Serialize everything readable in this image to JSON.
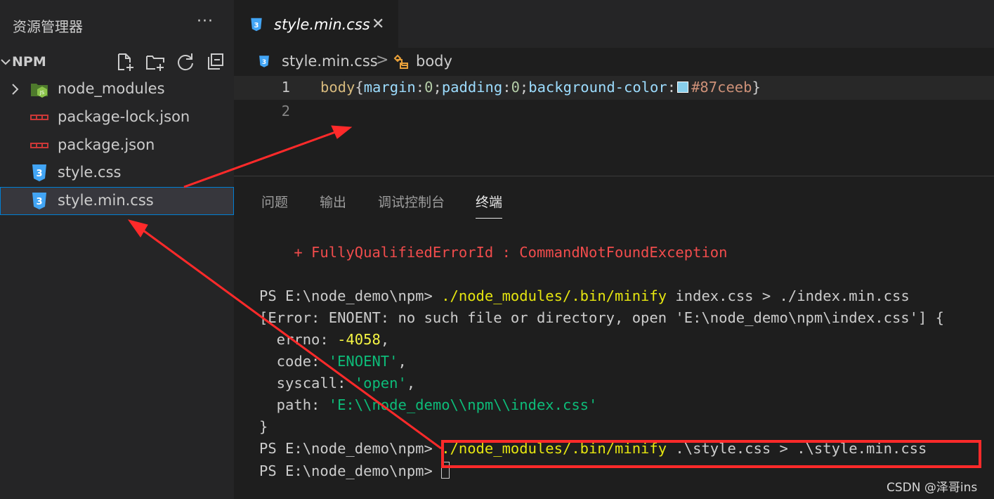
{
  "explorer": {
    "title": "资源管理器",
    "more_label": "···",
    "folder_name": "NPM",
    "files": [
      {
        "name": "node_modules",
        "icon": "nodejs-folder-icon",
        "kind": "folder"
      },
      {
        "name": "package-lock.json",
        "icon": "npm-icon",
        "kind": "file"
      },
      {
        "name": "package.json",
        "icon": "npm-icon",
        "kind": "file"
      },
      {
        "name": "style.css",
        "icon": "css3-icon",
        "kind": "file"
      },
      {
        "name": "style.min.css",
        "icon": "css3-icon",
        "kind": "file",
        "selected": true
      }
    ]
  },
  "editor": {
    "tab": {
      "label": "style.min.css",
      "close": "✕"
    },
    "breadcrumb": {
      "file": "style.min.css",
      "separator": ">",
      "symbol": "body"
    },
    "line_numbers": [
      "1",
      "2"
    ],
    "code_line1": {
      "selector": "body",
      "open": "{",
      "prop1": "margin",
      "colon1": ":",
      "val1": "0",
      "semi1": ";",
      "prop2": "padding",
      "colon2": ":",
      "val2": "0",
      "semi2": ";",
      "prop3": "background-color",
      "colon3": ":",
      "val3": "#87ceeb",
      "close": "}"
    },
    "swatch_color": "#87ceeb"
  },
  "panel": {
    "tabs": [
      "问题",
      "输出",
      "调试控制台",
      "终端"
    ],
    "active_tab": "终端"
  },
  "terminal": {
    "error_line": "    + FullyQualifiedErrorId : CommandNotFoundException",
    "prompt": "PS E:\\node_demo\\npm> ",
    "cmd1": "./node_modules/.bin/minify",
    "cmd1_args": " index.css > ./index.min.css",
    "err_open": "[Error: ENOENT: no such file or directory, open 'E:\\node_demo\\npm\\index.css'] {",
    "errno_key": "  errno: ",
    "errno_val": "-4058",
    "code_key": "  code: ",
    "code_val": "'ENOENT'",
    "syscall_key": "  syscall: ",
    "syscall_val": "'open'",
    "path_key": "  path: ",
    "path_val": "'E:\\\\node_demo\\\\npm\\\\index.css'",
    "comma": ",",
    "err_close": "}",
    "cmd2": "./node_modules/.bin/minify",
    "cmd2_args": " .\\style.css > .\\style.min.css"
  },
  "watermark": "CSDN @泽哥ins",
  "colors": {
    "highlight": "#ff2a2a",
    "selection_border": "#007fd4",
    "css_icon": "#42a5f5",
    "npm_icon": "#cb3837",
    "node_icon": "#8bc34a"
  }
}
